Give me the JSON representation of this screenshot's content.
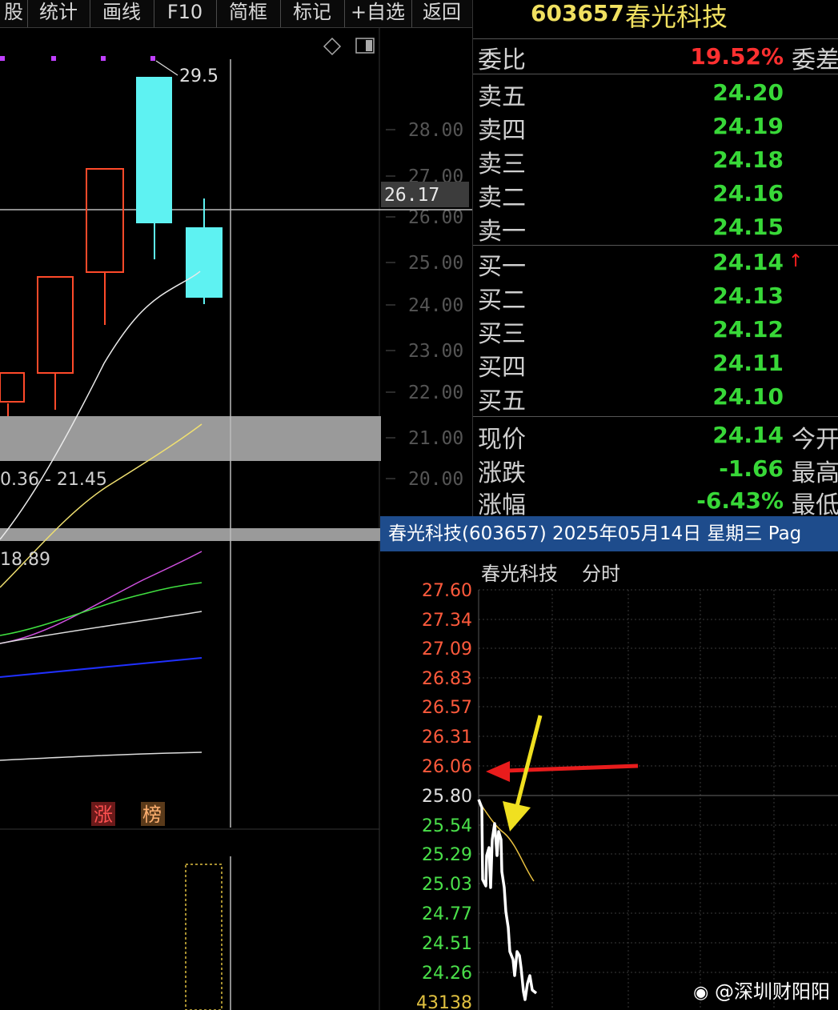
{
  "toolbar": {
    "items": [
      "股",
      "统计",
      "画线",
      "F10",
      "简框",
      "标记",
      "+自选",
      "返回"
    ]
  },
  "kline": {
    "high_label": "29.5",
    "price_ticks": [
      "28.00",
      "27.00",
      "26.00",
      "25.00",
      "24.00",
      "23.00",
      "22.00",
      "21.00",
      "20.00"
    ],
    "crosshair_price": "26.17",
    "band_label": "0.36 - 21.45",
    "ma_label": "18.89",
    "tags": [
      "涨",
      "榜"
    ]
  },
  "quote": {
    "code": "603657",
    "name": "春光科技",
    "weibi_label": "委比",
    "weibi_value": "19.52%",
    "weicha_label": "委差",
    "sell": [
      {
        "label": "卖五",
        "price": "24.20"
      },
      {
        "label": "卖四",
        "price": "24.19"
      },
      {
        "label": "卖三",
        "price": "24.18"
      },
      {
        "label": "卖二",
        "price": "24.16"
      },
      {
        "label": "卖一",
        "price": "24.15"
      }
    ],
    "buy": [
      {
        "label": "买一",
        "price": "24.14"
      },
      {
        "label": "买二",
        "price": "24.13"
      },
      {
        "label": "买三",
        "price": "24.12"
      },
      {
        "label": "买四",
        "price": "24.11"
      },
      {
        "label": "买五",
        "price": "24.10"
      }
    ],
    "stats": [
      {
        "label": "现价",
        "value": "24.14",
        "right_label": "今开"
      },
      {
        "label": "涨跌",
        "value": "-1.66",
        "right_label": "最高"
      },
      {
        "label": "涨幅",
        "value": "-6.43%",
        "right_label": "最低"
      }
    ]
  },
  "intraday": {
    "header": "春光科技(603657) 2025年05月14日 星期三 Pag",
    "subtitle_name": "春光科技",
    "subtitle_mode": "分时",
    "price_ticks": [
      "27.60",
      "27.34",
      "27.09",
      "26.83",
      "26.57",
      "26.31",
      "26.06",
      "25.80",
      "25.54",
      "25.29",
      "25.03",
      "24.77",
      "24.51",
      "24.26"
    ],
    "bottom_value": "43138"
  },
  "watermark": "@深圳财阳阳",
  "colors": {
    "up": "#ff3030",
    "down": "#38d838",
    "candle_down": "#5ef2f2",
    "header_bg": "#1e4c8c",
    "title": "#f0e060"
  }
}
